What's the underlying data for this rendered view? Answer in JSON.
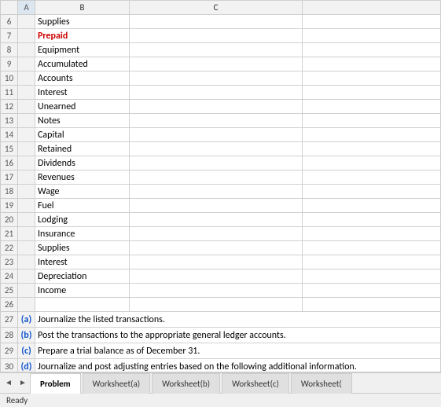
{
  "columns": {
    "row_num_header": "",
    "a_header": "A",
    "b_header": "B",
    "c_header": "C"
  },
  "rows": [
    {
      "row": "6",
      "a": "",
      "b": "Supplies",
      "c": ""
    },
    {
      "row": "7",
      "a": "",
      "b": "Prepaid",
      "c": "",
      "b_class": "prepaid-cell"
    },
    {
      "row": "8",
      "a": "",
      "b": "Equipment",
      "c": ""
    },
    {
      "row": "9",
      "a": "",
      "b": "Accumulated",
      "c": ""
    },
    {
      "row": "10",
      "a": "",
      "b": "Accounts",
      "c": ""
    },
    {
      "row": "11",
      "a": "",
      "b": "Interest",
      "c": ""
    },
    {
      "row": "12",
      "a": "",
      "b": "Unearned",
      "c": ""
    },
    {
      "row": "13",
      "a": "",
      "b": "Notes",
      "c": ""
    },
    {
      "row": "14",
      "a": "",
      "b": "Capital",
      "c": ""
    },
    {
      "row": "15",
      "a": "",
      "b": "Retained",
      "c": ""
    },
    {
      "row": "16",
      "a": "",
      "b": "Dividends",
      "c": ""
    },
    {
      "row": "17",
      "a": "",
      "b": "Revenues",
      "c": ""
    },
    {
      "row": "18",
      "a": "",
      "b": "Wage",
      "c": ""
    },
    {
      "row": "19",
      "a": "",
      "b": "Fuel",
      "c": ""
    },
    {
      "row": "20",
      "a": "",
      "b": "Lodging",
      "c": ""
    },
    {
      "row": "21",
      "a": "",
      "b": "Insurance",
      "c": ""
    },
    {
      "row": "22",
      "a": "",
      "b": "Supplies",
      "c": ""
    },
    {
      "row": "23",
      "a": "",
      "b": "Interest",
      "c": ""
    },
    {
      "row": "24",
      "a": "",
      "b": "Depreciation",
      "c": ""
    },
    {
      "row": "25",
      "a": "",
      "b": "Income",
      "c": ""
    },
    {
      "row": "26",
      "a": "",
      "b": "",
      "c": ""
    }
  ],
  "tasks": [
    {
      "row": "27",
      "label": "(a)",
      "text": "Journalize the listed transactions."
    },
    {
      "row": "28",
      "label": "(b)",
      "text": "Post the transactions to the appropriate general ledger accounts."
    },
    {
      "row": "29",
      "label": "(c)",
      "text": "Prepare a trial balance as of December 31."
    },
    {
      "row": "30",
      "label": "(d)",
      "text": "Journalize and post adjusting entries based on the following additional information."
    }
  ],
  "tabs": [
    {
      "label": "Problem",
      "active": true
    },
    {
      "label": "Worksheet(a)",
      "active": false
    },
    {
      "label": "Worksheet(b)",
      "active": false
    },
    {
      "label": "Worksheet(c)",
      "active": false
    },
    {
      "label": "Worksheet(",
      "active": false
    }
  ],
  "status": "Ready"
}
